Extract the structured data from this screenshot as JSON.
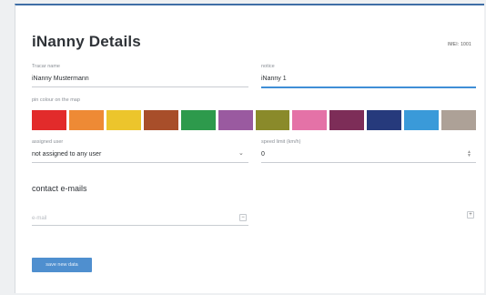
{
  "header": {
    "title": "iNanny Details",
    "imei": "IMEI: 1001"
  },
  "fields": {
    "tracar_name": {
      "label": "Tracar name",
      "value": "iNanny Mustermann"
    },
    "notice": {
      "label": "notice",
      "value": "iNanny 1"
    },
    "pin_colour": {
      "label": "pin colour on the map"
    },
    "assigned_user": {
      "label": "assigned user",
      "value": "not assigned to any user"
    },
    "speed_limit": {
      "label": "speed limit (km/h)",
      "value": "0"
    }
  },
  "colors": [
    {
      "name": "red",
      "hex": "#e22b2b"
    },
    {
      "name": "orange",
      "hex": "#ee8a35"
    },
    {
      "name": "yellow",
      "hex": "#ecc52c"
    },
    {
      "name": "rust",
      "hex": "#a84e2a"
    },
    {
      "name": "green",
      "hex": "#2d9a4c"
    },
    {
      "name": "violet",
      "hex": "#9a5aa0"
    },
    {
      "name": "olive",
      "hex": "#8a8a2a"
    },
    {
      "name": "pink",
      "hex": "#e472a7"
    },
    {
      "name": "plum",
      "hex": "#7d2d58"
    },
    {
      "name": "navy",
      "hex": "#263a7c"
    },
    {
      "name": "sky-blue",
      "hex": "#3a9ad9"
    },
    {
      "name": "taupe",
      "hex": "#ada197"
    }
  ],
  "contact": {
    "section_title": "contact e-mails",
    "email_placeholder": "e-mail"
  },
  "actions": {
    "save_label": "save new data"
  },
  "theme": {
    "accent": "#3f8ed6",
    "button": "#4f8fcf"
  }
}
